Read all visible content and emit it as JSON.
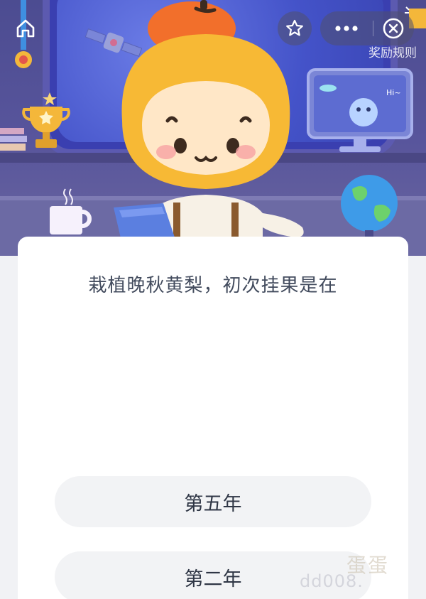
{
  "header": {
    "icons": {
      "home": "home-icon",
      "favorite": "star-icon",
      "more": "more-dots-icon",
      "close": "close-circle-icon"
    },
    "rules_link": "奖励规则"
  },
  "quiz": {
    "question": "栽植晚秋黄梨，初次挂果是在",
    "options": [
      {
        "label": "第五年"
      },
      {
        "label": "第二年"
      }
    ]
  },
  "watermark": {
    "logo": "蛋蛋",
    "url": "dd008."
  },
  "colors": {
    "hero_bg": "#58559c",
    "card_bg": "#ffffff",
    "option_bg": "#f2f3f5",
    "text": "#424b5d"
  }
}
